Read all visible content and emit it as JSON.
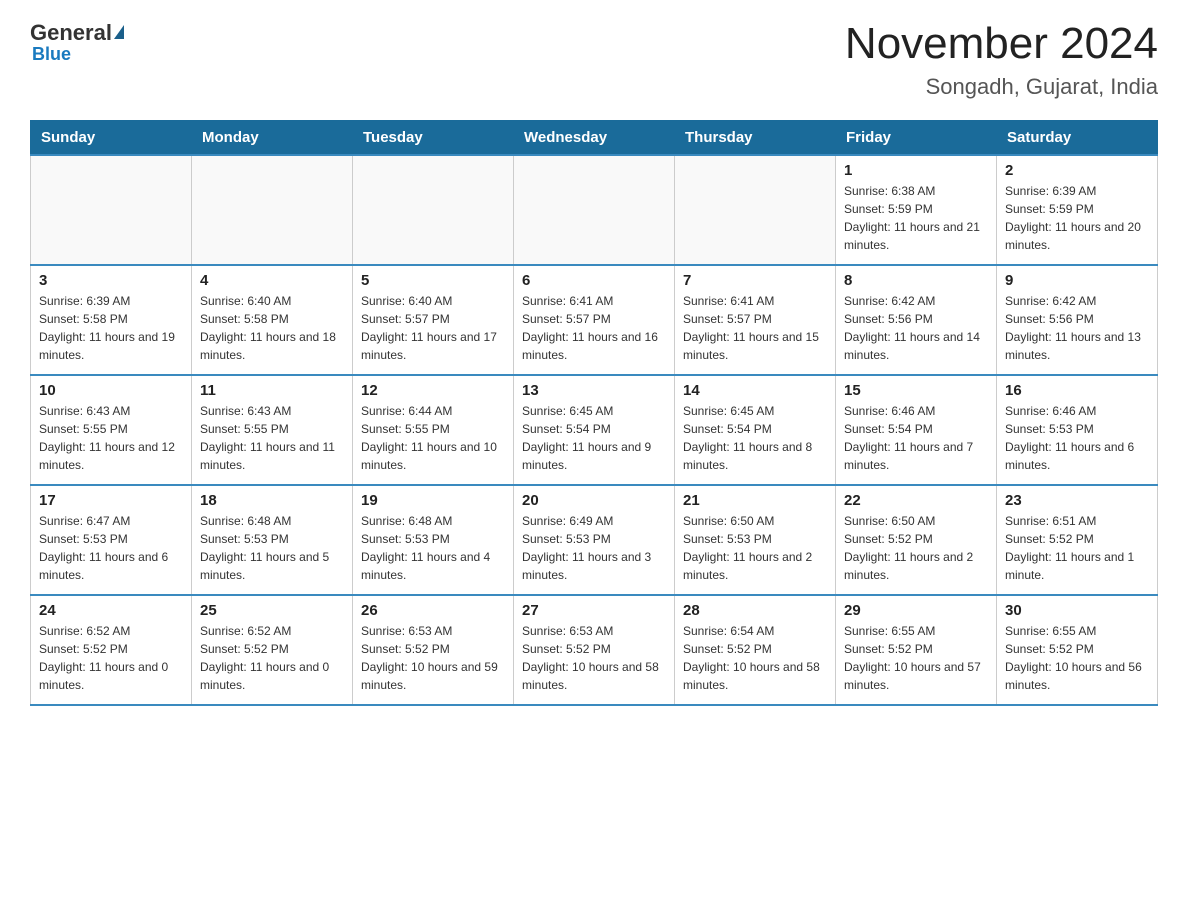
{
  "logo": {
    "general": "General",
    "blue": "Blue"
  },
  "header": {
    "title": "November 2024",
    "subtitle": "Songadh, Gujarat, India"
  },
  "weekdays": [
    "Sunday",
    "Monday",
    "Tuesday",
    "Wednesday",
    "Thursday",
    "Friday",
    "Saturday"
  ],
  "weeks": [
    [
      {
        "day": "",
        "info": ""
      },
      {
        "day": "",
        "info": ""
      },
      {
        "day": "",
        "info": ""
      },
      {
        "day": "",
        "info": ""
      },
      {
        "day": "",
        "info": ""
      },
      {
        "day": "1",
        "info": "Sunrise: 6:38 AM\nSunset: 5:59 PM\nDaylight: 11 hours and 21 minutes."
      },
      {
        "day": "2",
        "info": "Sunrise: 6:39 AM\nSunset: 5:59 PM\nDaylight: 11 hours and 20 minutes."
      }
    ],
    [
      {
        "day": "3",
        "info": "Sunrise: 6:39 AM\nSunset: 5:58 PM\nDaylight: 11 hours and 19 minutes."
      },
      {
        "day": "4",
        "info": "Sunrise: 6:40 AM\nSunset: 5:58 PM\nDaylight: 11 hours and 18 minutes."
      },
      {
        "day": "5",
        "info": "Sunrise: 6:40 AM\nSunset: 5:57 PM\nDaylight: 11 hours and 17 minutes."
      },
      {
        "day": "6",
        "info": "Sunrise: 6:41 AM\nSunset: 5:57 PM\nDaylight: 11 hours and 16 minutes."
      },
      {
        "day": "7",
        "info": "Sunrise: 6:41 AM\nSunset: 5:57 PM\nDaylight: 11 hours and 15 minutes."
      },
      {
        "day": "8",
        "info": "Sunrise: 6:42 AM\nSunset: 5:56 PM\nDaylight: 11 hours and 14 minutes."
      },
      {
        "day": "9",
        "info": "Sunrise: 6:42 AM\nSunset: 5:56 PM\nDaylight: 11 hours and 13 minutes."
      }
    ],
    [
      {
        "day": "10",
        "info": "Sunrise: 6:43 AM\nSunset: 5:55 PM\nDaylight: 11 hours and 12 minutes."
      },
      {
        "day": "11",
        "info": "Sunrise: 6:43 AM\nSunset: 5:55 PM\nDaylight: 11 hours and 11 minutes."
      },
      {
        "day": "12",
        "info": "Sunrise: 6:44 AM\nSunset: 5:55 PM\nDaylight: 11 hours and 10 minutes."
      },
      {
        "day": "13",
        "info": "Sunrise: 6:45 AM\nSunset: 5:54 PM\nDaylight: 11 hours and 9 minutes."
      },
      {
        "day": "14",
        "info": "Sunrise: 6:45 AM\nSunset: 5:54 PM\nDaylight: 11 hours and 8 minutes."
      },
      {
        "day": "15",
        "info": "Sunrise: 6:46 AM\nSunset: 5:54 PM\nDaylight: 11 hours and 7 minutes."
      },
      {
        "day": "16",
        "info": "Sunrise: 6:46 AM\nSunset: 5:53 PM\nDaylight: 11 hours and 6 minutes."
      }
    ],
    [
      {
        "day": "17",
        "info": "Sunrise: 6:47 AM\nSunset: 5:53 PM\nDaylight: 11 hours and 6 minutes."
      },
      {
        "day": "18",
        "info": "Sunrise: 6:48 AM\nSunset: 5:53 PM\nDaylight: 11 hours and 5 minutes."
      },
      {
        "day": "19",
        "info": "Sunrise: 6:48 AM\nSunset: 5:53 PM\nDaylight: 11 hours and 4 minutes."
      },
      {
        "day": "20",
        "info": "Sunrise: 6:49 AM\nSunset: 5:53 PM\nDaylight: 11 hours and 3 minutes."
      },
      {
        "day": "21",
        "info": "Sunrise: 6:50 AM\nSunset: 5:53 PM\nDaylight: 11 hours and 2 minutes."
      },
      {
        "day": "22",
        "info": "Sunrise: 6:50 AM\nSunset: 5:52 PM\nDaylight: 11 hours and 2 minutes."
      },
      {
        "day": "23",
        "info": "Sunrise: 6:51 AM\nSunset: 5:52 PM\nDaylight: 11 hours and 1 minute."
      }
    ],
    [
      {
        "day": "24",
        "info": "Sunrise: 6:52 AM\nSunset: 5:52 PM\nDaylight: 11 hours and 0 minutes."
      },
      {
        "day": "25",
        "info": "Sunrise: 6:52 AM\nSunset: 5:52 PM\nDaylight: 11 hours and 0 minutes."
      },
      {
        "day": "26",
        "info": "Sunrise: 6:53 AM\nSunset: 5:52 PM\nDaylight: 10 hours and 59 minutes."
      },
      {
        "day": "27",
        "info": "Sunrise: 6:53 AM\nSunset: 5:52 PM\nDaylight: 10 hours and 58 minutes."
      },
      {
        "day": "28",
        "info": "Sunrise: 6:54 AM\nSunset: 5:52 PM\nDaylight: 10 hours and 58 minutes."
      },
      {
        "day": "29",
        "info": "Sunrise: 6:55 AM\nSunset: 5:52 PM\nDaylight: 10 hours and 57 minutes."
      },
      {
        "day": "30",
        "info": "Sunrise: 6:55 AM\nSunset: 5:52 PM\nDaylight: 10 hours and 56 minutes."
      }
    ]
  ]
}
